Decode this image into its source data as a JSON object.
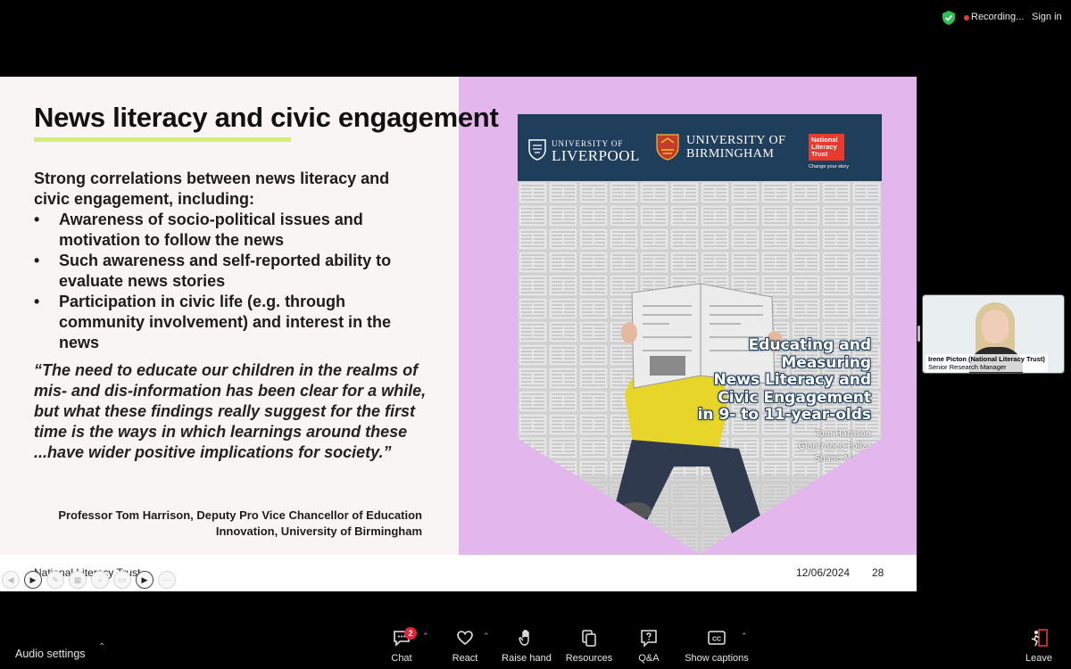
{
  "topbar": {
    "recording_label": "Recording...",
    "signin_label": "Sign in"
  },
  "slide": {
    "title": "News literacy and civic engagement",
    "intro": "Strong correlations between news literacy and civic engagement, including:",
    "bullets": [
      "Awareness of socio-political issues and motivation to follow the news",
      "Such awareness and self-reported ability to evaluate news stories",
      "Participation in civic life (e.g. through community involvement) and interest in the news"
    ],
    "quote": "“The need to educate our children in the realms of mis- and dis-information has been clear for a while, but what these findings really suggest for the first time is the ways in which learnings around these ...have wider positive implications for society.”",
    "attribution": "Professor Tom Harrison, Deputy Pro Vice Chancellor of Education Innovation, University of Birmingham",
    "footer_org": "National Literacy Trust",
    "footer_date": "12/06/2024",
    "page_number": "28",
    "colors": {
      "right_panel": "#e4b6ee",
      "underline": "#d6ec78",
      "cover_header": "#1f3e5c"
    }
  },
  "cover": {
    "logo_liverpool_small": "UNIVERSITY OF",
    "logo_liverpool_big": "LIVERPOOL",
    "logo_birmingham_1": "UNIVERSITY OF",
    "logo_birmingham_2": "BIRMINGHAM",
    "logo_nlt": "National Literacy Trust",
    "logo_nlt_tagline": "Change your story",
    "title_lines": [
      "Educating and",
      "Measuring",
      "News Literacy and",
      "Civic Engagement",
      "in 9- to 11-year-olds"
    ],
    "authors": [
      "Tom Harrison",
      "Gianfranco Polizz",
      "Shane McLou"
    ]
  },
  "participant": {
    "name": "Irene Picton (National Literacy Trust)",
    "role": "Senior Research Manager"
  },
  "toolbar": {
    "audio_settings": "Audio settings",
    "chat": "Chat",
    "chat_badge": "2",
    "react": "React",
    "raise_hand": "Raise hand",
    "resources": "Resources",
    "qa": "Q&A",
    "captions": "Show captions",
    "leave": "Leave"
  }
}
